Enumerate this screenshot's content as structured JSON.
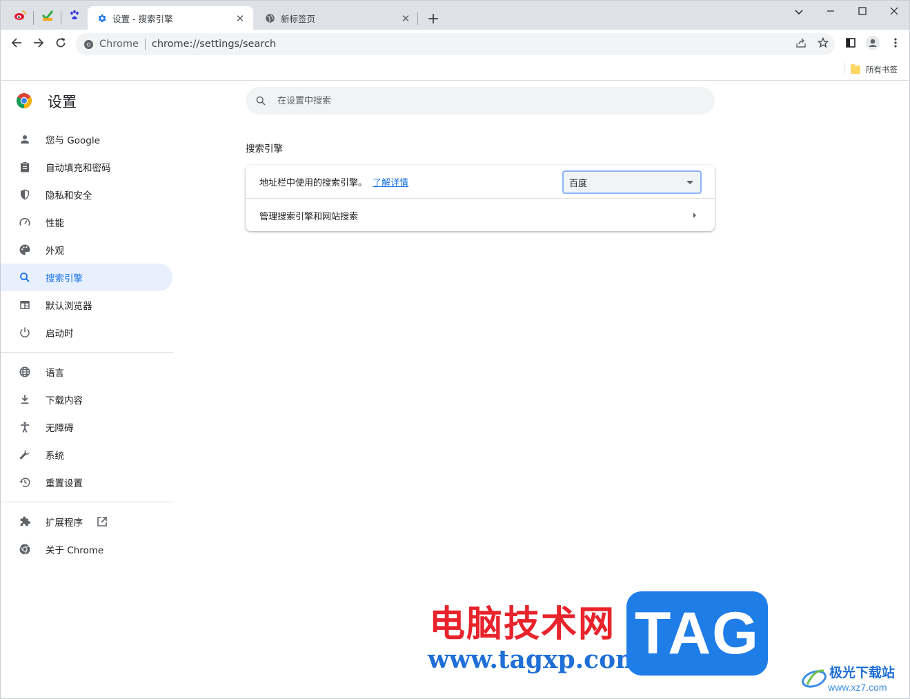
{
  "browser": {
    "tabs": [
      {
        "title": "设置 - 搜索引擎",
        "active": true
      },
      {
        "title": "新标签页",
        "active": false
      }
    ],
    "address": {
      "chip": "Chrome",
      "url": "chrome://settings/search"
    },
    "bookmarks_folder": "所有书签"
  },
  "settings": {
    "title": "设置",
    "search_placeholder": "在设置中搜索",
    "sidebar": {
      "items": [
        {
          "label": "您与 Google",
          "icon": "person-icon"
        },
        {
          "label": "自动填充和密码",
          "icon": "clipboard-icon"
        },
        {
          "label": "隐私和安全",
          "icon": "shield-icon"
        },
        {
          "label": "性能",
          "icon": "speedometer-icon"
        },
        {
          "label": "外观",
          "icon": "palette-icon"
        },
        {
          "label": "搜索引擎",
          "icon": "search-icon",
          "active": true
        },
        {
          "label": "默认浏览器",
          "icon": "browser-window-icon"
        },
        {
          "label": "启动时",
          "icon": "power-icon"
        },
        {
          "label": "语言",
          "icon": "globe-icon"
        },
        {
          "label": "下载内容",
          "icon": "download-icon"
        },
        {
          "label": "无障碍",
          "icon": "accessibility-icon"
        },
        {
          "label": "系统",
          "icon": "wrench-icon"
        },
        {
          "label": "重置设置",
          "icon": "history-icon"
        },
        {
          "label": "扩展程序",
          "icon": "puzzle-icon"
        },
        {
          "label": "关于 Chrome",
          "icon": "chrome-icon"
        }
      ]
    },
    "section": {
      "title": "搜索引擎",
      "row1_label": "地址栏中使用的搜索引擎。",
      "row1_link": "了解详情",
      "selected_engine": "百度",
      "row2_label": "管理搜索引擎和网站搜索"
    }
  },
  "watermark": {
    "brand_cn": "电脑技术网",
    "url": "www.tagxp.com",
    "tag": "TAG",
    "site_name": "极光下载站",
    "site_url": "www.xz7.com"
  },
  "colors": {
    "accent": "#1a73e8",
    "active_item_bg": "#e8f0fe",
    "tabstrip_bg": "#dee1e6",
    "watermark_red": "#e8232b",
    "watermark_blue": "#1f7de8"
  }
}
